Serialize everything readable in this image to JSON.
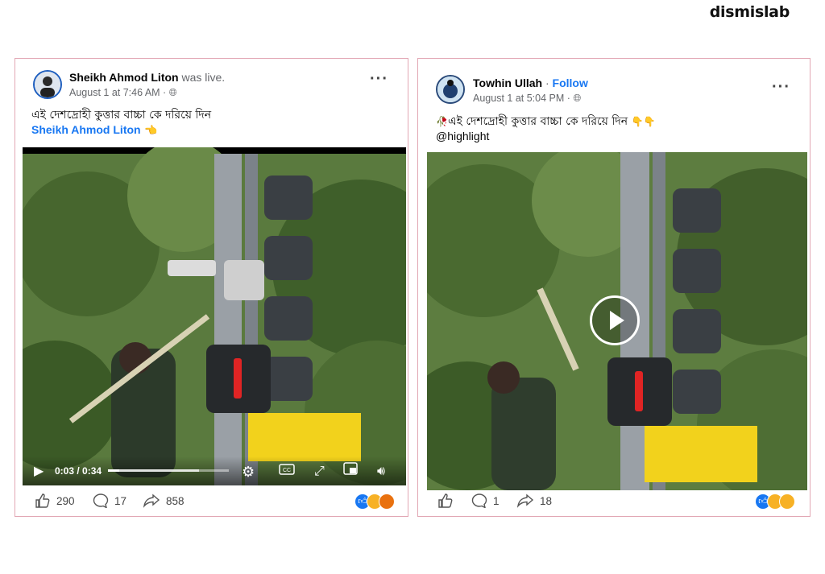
{
  "brand": "dismislab",
  "posts": [
    {
      "author": "Sheikh Ahmod Liton",
      "status_suffix": "was live.",
      "meta": "August 1 at 7:46 AM · ",
      "caption": "এই দেশদ্রোহী কুত্তার বাচ্চা কে দরিয়ে দিন",
      "link": "Sheikh Ahmod Liton",
      "link_emoji": "👈",
      "video": {
        "time": "0:03 / 0:34",
        "progress": 0.09,
        "buffered": 0.75
      },
      "stats": {
        "likes": "290",
        "comments": "17",
        "shares": "858"
      },
      "reactions": [
        "like-icon",
        "sad-icon",
        "angry-icon"
      ]
    },
    {
      "author": "Towhin Ullah",
      "follow": "Follow",
      "meta": "August 1 at 5:04 PM · ",
      "caption_prefix_emoji": "🥀",
      "caption": "এই দেশদ্রোহী কুত্তার বাচ্চা কে দরিয়ে দিন",
      "caption_emoji": "👇👇",
      "hashtag": "@highlight",
      "stats": {
        "likes": "",
        "comments": "1",
        "shares": "18"
      },
      "reactions": [
        "like-icon",
        "wow-icon",
        "sad-icon"
      ]
    }
  ],
  "colors": {
    "accent": "#1877f2",
    "border": "#e2a7b4"
  }
}
